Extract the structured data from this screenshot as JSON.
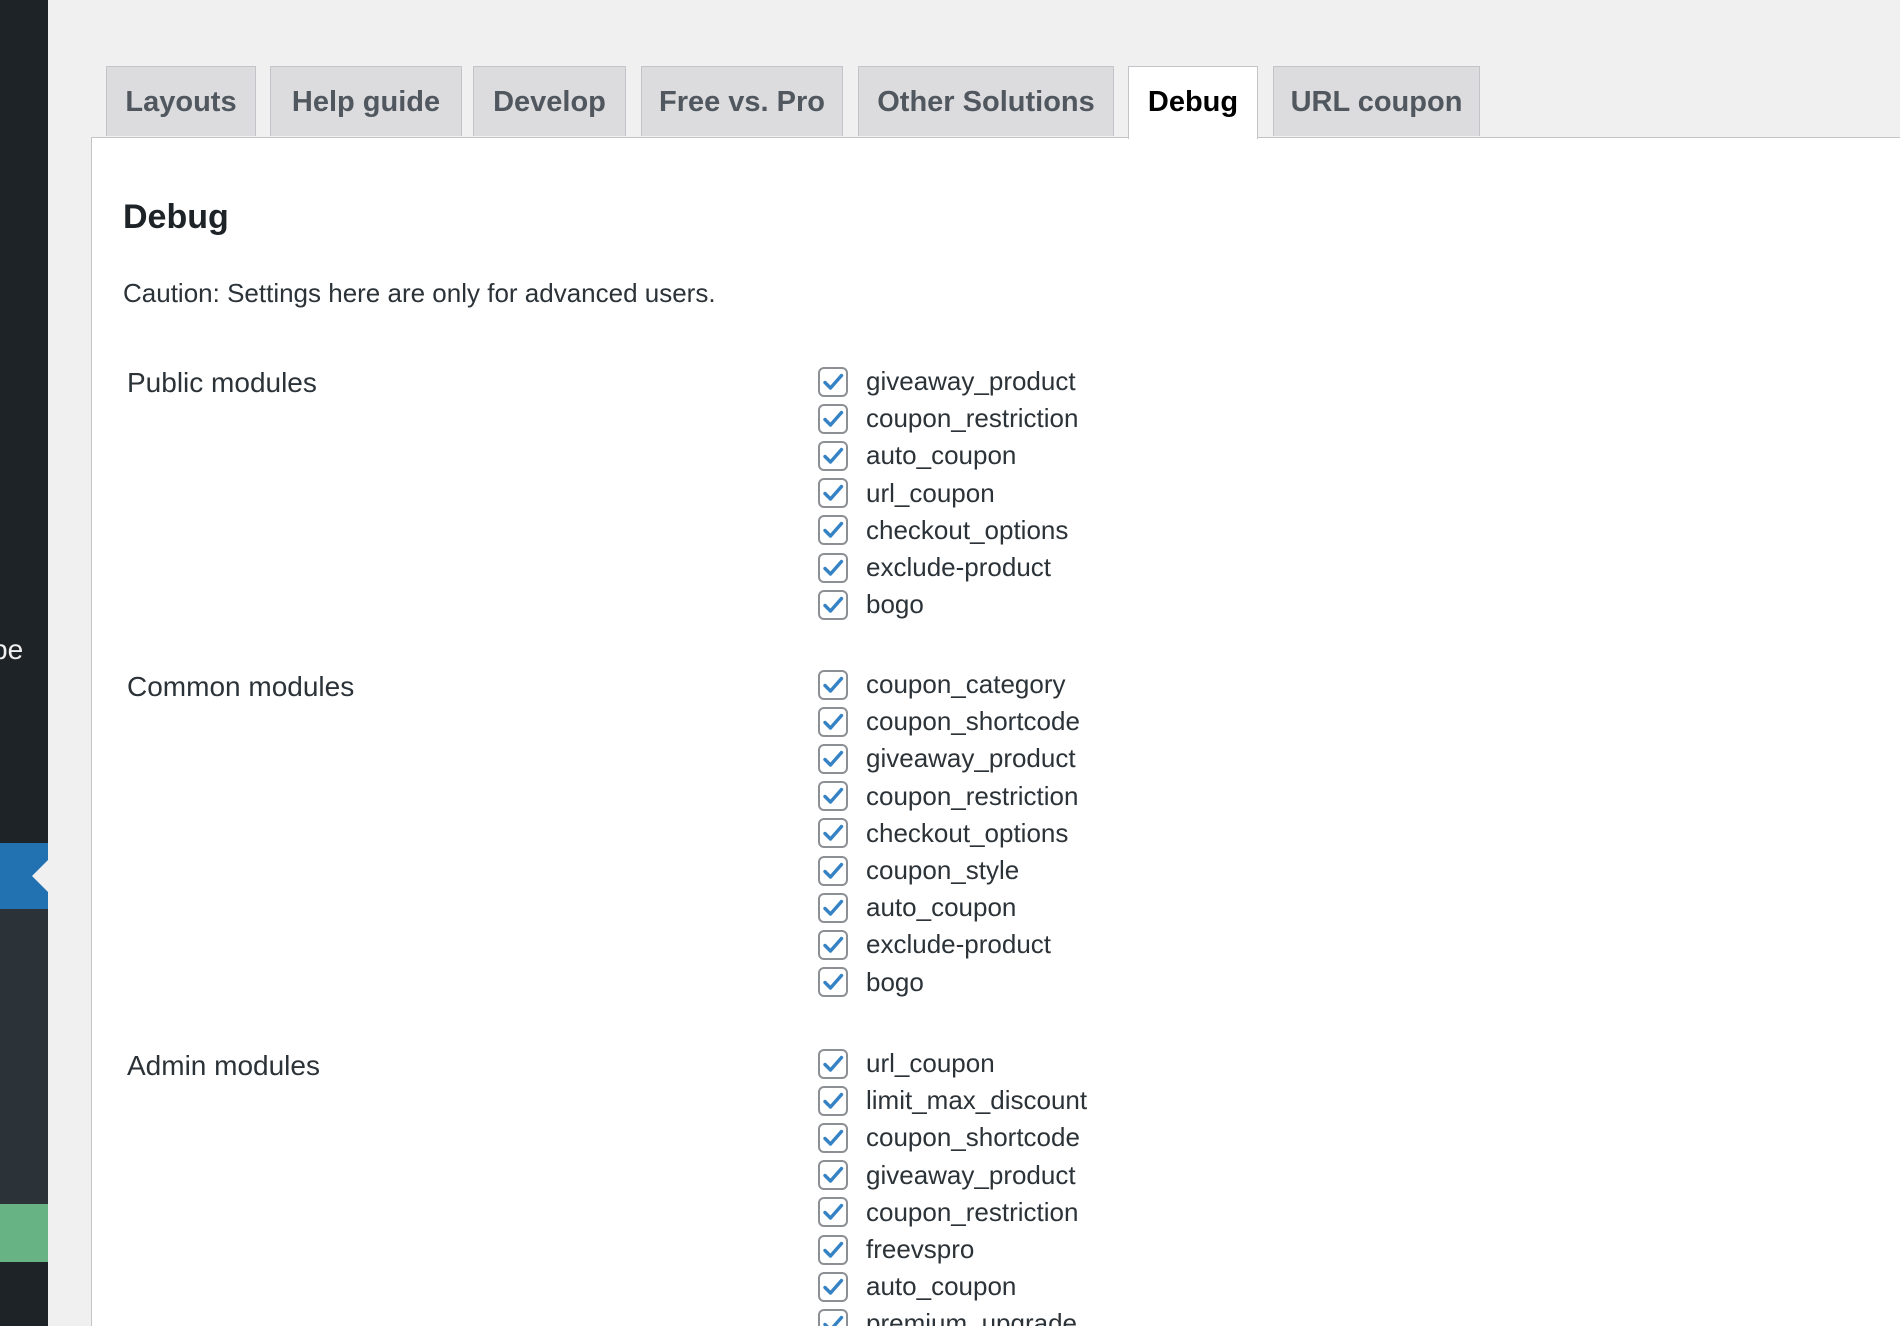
{
  "sidebar": {
    "partial_text": "pe"
  },
  "tabs": [
    {
      "label": "Layouts",
      "active": false
    },
    {
      "label": "Help guide",
      "active": false
    },
    {
      "label": "Develop",
      "active": false
    },
    {
      "label": "Free vs. Pro",
      "active": false
    },
    {
      "label": "Other Solutions",
      "active": false
    },
    {
      "label": "Debug",
      "active": true
    },
    {
      "label": "URL coupon",
      "active": false
    }
  ],
  "page": {
    "title": "Debug",
    "caution": "Caution: Settings here are only for advanced users."
  },
  "sections": [
    {
      "label": "Public modules",
      "items": [
        {
          "name": "giveaway_product",
          "checked": true
        },
        {
          "name": "coupon_restriction",
          "checked": true
        },
        {
          "name": "auto_coupon",
          "checked": true
        },
        {
          "name": "url_coupon",
          "checked": true
        },
        {
          "name": "checkout_options",
          "checked": true
        },
        {
          "name": "exclude-product",
          "checked": true
        },
        {
          "name": "bogo",
          "checked": true
        }
      ]
    },
    {
      "label": "Common modules",
      "items": [
        {
          "name": "coupon_category",
          "checked": true
        },
        {
          "name": "coupon_shortcode",
          "checked": true
        },
        {
          "name": "giveaway_product",
          "checked": true
        },
        {
          "name": "coupon_restriction",
          "checked": true
        },
        {
          "name": "checkout_options",
          "checked": true
        },
        {
          "name": "coupon_style",
          "checked": true
        },
        {
          "name": "auto_coupon",
          "checked": true
        },
        {
          "name": "exclude-product",
          "checked": true
        },
        {
          "name": "bogo",
          "checked": true
        }
      ]
    },
    {
      "label": "Admin modules",
      "items": [
        {
          "name": "url_coupon",
          "checked": true
        },
        {
          "name": "limit_max_discount",
          "checked": true
        },
        {
          "name": "coupon_shortcode",
          "checked": true
        },
        {
          "name": "giveaway_product",
          "checked": true
        },
        {
          "name": "coupon_restriction",
          "checked": true
        },
        {
          "name": "freevspro",
          "checked": true
        },
        {
          "name": "auto_coupon",
          "checked": true
        },
        {
          "name": "premium_upgrade",
          "checked": true
        }
      ]
    }
  ],
  "colors": {
    "checkmark": "#3582c4",
    "sidebar_bg": "#1d2327",
    "active_menu": "#2271b1",
    "green_block": "#68b383"
  }
}
